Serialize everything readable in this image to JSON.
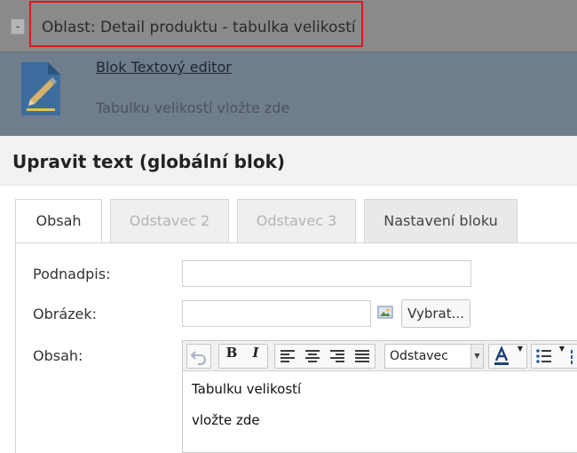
{
  "background": {
    "collapse_label": "-",
    "area_title": "Oblast: Detail produktu - tabulka velikostí",
    "block_title": "Blok Textový editor",
    "block_description": "Tabulku velikostí vložte zde",
    "highlight_color": "#e2151b"
  },
  "dialog": {
    "title": "Upravit text (globální blok)",
    "tabs": [
      {
        "label": "Obsah",
        "state": "active"
      },
      {
        "label": "Odstavec 2",
        "state": "disabled"
      },
      {
        "label": "Odstavec 3",
        "state": "disabled"
      },
      {
        "label": "Nastavení bloku",
        "state": "normal"
      }
    ],
    "fields": {
      "subtitle_label": "Podnadpis:",
      "subtitle_value": "",
      "image_label": "Obrázek:",
      "image_value": "",
      "select_button": "Vybrat...",
      "content_label": "Obsah:"
    },
    "editor": {
      "toolbar": {
        "undo_icon": "undo-icon",
        "bold": "B",
        "italic": "I",
        "align_icons": [
          "align-left-icon",
          "align-center-icon",
          "align-right-icon",
          "align-justify-icon"
        ],
        "format_value": "Odstavec",
        "font_color_icon": "font-color-icon",
        "list_icon": "bulleted-list-icon"
      },
      "content_lines": [
        "Tabulku velikostí",
        "vložte zde"
      ]
    }
  }
}
